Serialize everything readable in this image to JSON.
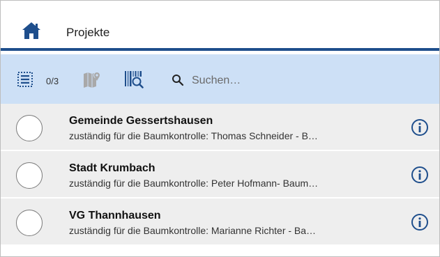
{
  "header": {
    "title": "Projekte",
    "icon": "home-icon"
  },
  "toolbar": {
    "count": "0/3",
    "icons": [
      "select-list-icon",
      "map-icon",
      "barcode-scan-icon",
      "search-icon"
    ],
    "search_placeholder": "Suchen…"
  },
  "projects": [
    {
      "name": "Gemeinde Gessertshausen",
      "description": "zuständig für die Baumkontrolle: Thomas Schneider - B…"
    },
    {
      "name": "Stadt Krumbach",
      "description": "zuständig für die Baumkontrolle: Peter Hofmann- Baum…"
    },
    {
      "name": "VG Thannhausen",
      "description": "zuständig für die Baumkontrolle: Marianne Richter - Ba…"
    }
  ],
  "colors": {
    "brand": "#1e4e8c",
    "toolbar_bg": "#cde0f6",
    "row_alt": "#eeeeee"
  }
}
